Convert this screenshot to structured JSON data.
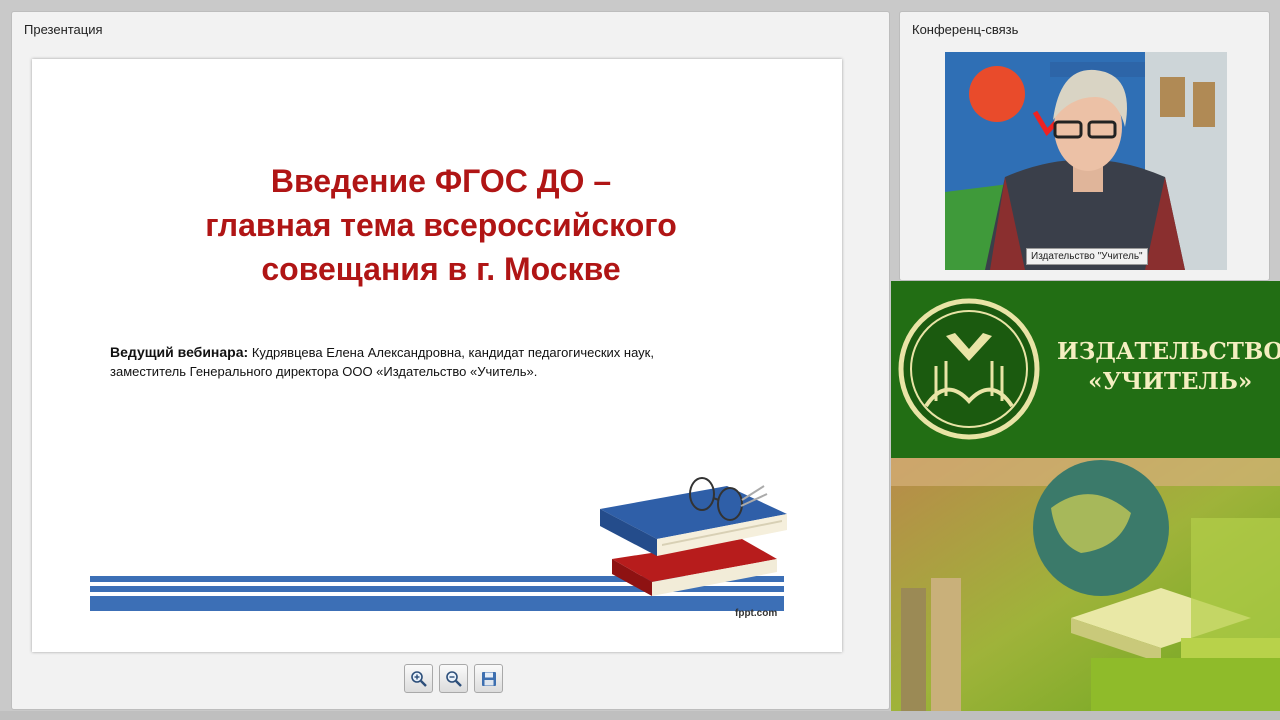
{
  "presentation": {
    "panel_title": "Презентация",
    "slide": {
      "title_lines": [
        "Введение ФГОС ДО –",
        "главная тема всероссийского",
        "совещания в г. Москве"
      ],
      "presenter_label": "Ведущий вебинара:",
      "presenter_text_line1": "Кудрявцева Елена Александровна, кандидат педагогических наук,",
      "presenter_text_line2": "заместитель Генерального директора ООО «Издательство «Учитель».",
      "footer_brand": "fppt.com"
    },
    "toolbar": {
      "zoom_in": "zoom-in-icon",
      "zoom_out": "zoom-out-icon",
      "save": "save-icon"
    }
  },
  "conference": {
    "panel_title": "Конференц-связь",
    "video_label": "Издательство \"Учитель\""
  },
  "banner": {
    "line1": "ИЗДАТЕЛЬСТВО",
    "line2": "«УЧИТЕЛЬ»"
  },
  "colors": {
    "title_red": "#b01515",
    "stripe_blue": "#3c6fb6",
    "banner_green": "#226e14",
    "banner_text": "#f4eec0"
  }
}
